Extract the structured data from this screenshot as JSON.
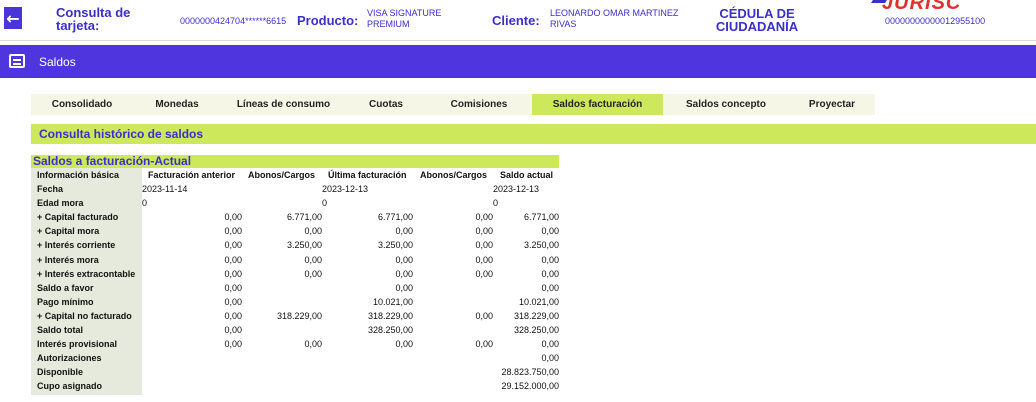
{
  "header": {
    "card_label": "Consulta de tarjeta:",
    "card_number": "0000000424704******6615",
    "product_label": "Producto:",
    "product_value": "VISA SIGNATURE PREMIUM",
    "client_label": "Cliente:",
    "client_value": "LEONARDO OMAR MARTINEZ RIVAS",
    "id_type": "CÉDULA DE CIUDADANÍA",
    "id_number": "00000000000012955100",
    "logo_text": "JURISC"
  },
  "section": {
    "title": "Saldos"
  },
  "tabs": [
    {
      "label": "Consolidado",
      "active": false
    },
    {
      "label": "Monedas",
      "active": false
    },
    {
      "label": "Líneas de consumo",
      "active": false
    },
    {
      "label": "Cuotas",
      "active": false
    },
    {
      "label": "Comisiones",
      "active": false
    },
    {
      "label": "Saldos facturación",
      "active": true
    },
    {
      "label": "Saldos concepto",
      "active": false
    },
    {
      "label": "Proyectar",
      "active": false
    }
  ],
  "history": {
    "title": "Consulta histórico de saldos"
  },
  "table": {
    "title": "Saldos a facturación-Actual",
    "headers": [
      "Información básica",
      "Facturación anterior",
      "Abonos/Cargos",
      "Última facturación",
      "Abonos/Cargos",
      "Saldo actual"
    ],
    "rows": [
      {
        "label": "Fecha",
        "c1": "2023-11-14",
        "c2": "",
        "c3": "2023-12-13",
        "c4": "",
        "c5": "2023-12-13"
      },
      {
        "label": "Edad mora",
        "c1": "0",
        "c2": "",
        "c3": "0",
        "c4": "",
        "c5": "0"
      },
      {
        "label": "+ Capital facturado",
        "c1": "0,00",
        "c2": "6.771,00",
        "c3": "6.771,00",
        "c4": "0,00",
        "c5": "6.771,00"
      },
      {
        "label": "+ Capital mora",
        "c1": "0,00",
        "c2": "0,00",
        "c3": "0,00",
        "c4": "0,00",
        "c5": "0,00"
      },
      {
        "label": "+ Interés corriente",
        "c1": "0,00",
        "c2": "3.250,00",
        "c3": "3.250,00",
        "c4": "0,00",
        "c5": "3.250,00"
      },
      {
        "label": "+ Interés mora",
        "c1": "0,00",
        "c2": "0,00",
        "c3": "0,00",
        "c4": "0,00",
        "c5": "0,00"
      },
      {
        "label": "+ Interés extracontable",
        "c1": "0,00",
        "c2": "0,00",
        "c3": "0,00",
        "c4": "0,00",
        "c5": "0,00"
      },
      {
        "label": "Saldo a favor",
        "c1": "0,00",
        "c2": "",
        "c3": "0,00",
        "c4": "",
        "c5": "0,00"
      },
      {
        "label": "Pago mínimo",
        "c1": "0,00",
        "c2": "",
        "c3": "10.021,00",
        "c4": "",
        "c5": "10.021,00"
      },
      {
        "label": "+ Capital no facturado",
        "c1": "0,00",
        "c2": "318.229,00",
        "c3": "318.229,00",
        "c4": "0,00",
        "c5": "318.229,00"
      },
      {
        "label": "Saldo total",
        "c1": "0,00",
        "c2": "",
        "c3": "328.250,00",
        "c4": "",
        "c5": "328.250,00"
      },
      {
        "label": "Interés provisional",
        "c1": "0,00",
        "c2": "0,00",
        "c3": "0,00",
        "c4": "0,00",
        "c5": "0,00"
      },
      {
        "label": "Autorizaciones",
        "c1": "",
        "c2": "",
        "c3": "",
        "c4": "",
        "c5": "0,00"
      },
      {
        "label": "Disponible",
        "c1": "",
        "c2": "",
        "c3": "",
        "c4": "",
        "c5": "28.823.750,00"
      },
      {
        "label": "Cupo asignado",
        "c1": "",
        "c2": "",
        "c3": "",
        "c4": "",
        "c5": "29.152.000,00"
      }
    ]
  }
}
